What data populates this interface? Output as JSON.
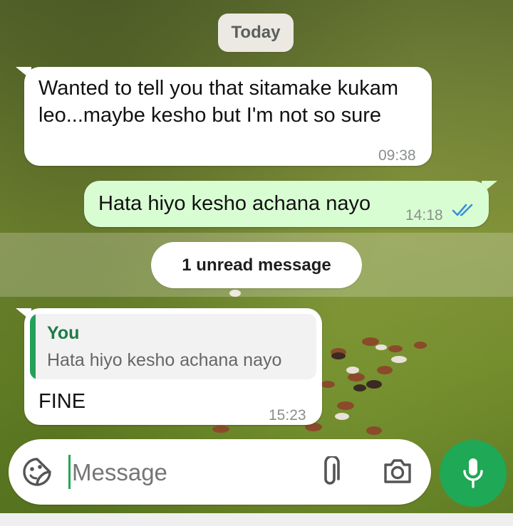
{
  "date_separator": "Today",
  "messages": [
    {
      "text": "Wanted to tell you that sitamake kukam leo...maybe kesho but I'm not so sure",
      "time": "09:38"
    },
    {
      "text": "Hata hiyo kesho achana nayo",
      "time": "14:18",
      "status": "read"
    },
    {
      "text": "FINE",
      "time": "15:23",
      "reply_to": {
        "sender": "You",
        "text": "Hata hiyo kesho achana nayo"
      }
    }
  ],
  "unread_banner": "1 unread message",
  "composer": {
    "placeholder": "Message"
  },
  "colors": {
    "outgoing_bubble": "#d9fdd3",
    "incoming_bubble": "#ffffff",
    "accent_green": "#1fa855",
    "read_ticks": "#3b8fd6",
    "quote_name": "#1f7a46"
  },
  "icons": {
    "emoji": "sticker-icon",
    "attach": "paperclip-icon",
    "camera": "camera-icon",
    "mic": "microphone-icon",
    "read": "double-check-icon"
  }
}
